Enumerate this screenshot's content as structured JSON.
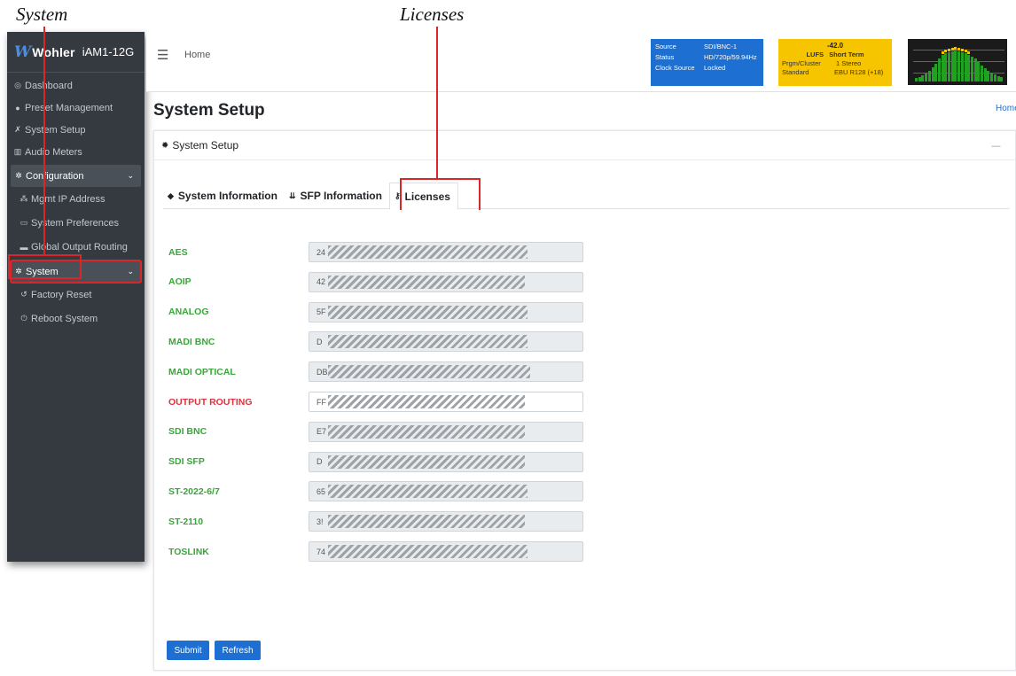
{
  "annotations": {
    "system": "System",
    "licenses": "Licenses"
  },
  "sidebar": {
    "brand_name": "Wohler",
    "brand_model": "iAM1-12G",
    "items": [
      {
        "label": "Dashboard",
        "icon": "tachometer-icon",
        "glyph": "◎"
      },
      {
        "label": "Preset Management",
        "icon": "users-icon",
        "glyph": "👥"
      },
      {
        "label": "System Setup",
        "icon": "tools-icon",
        "glyph": "✗"
      },
      {
        "label": "Audio Meters",
        "icon": "chart-icon",
        "glyph": "▥"
      }
    ],
    "configuration": {
      "label": "Configuration",
      "children": [
        {
          "label": "Mgmt IP Address",
          "icon": "network-icon",
          "glyph": "⁂"
        },
        {
          "label": "System Preferences",
          "icon": "sliders-icon",
          "glyph": "▭"
        },
        {
          "label": "Global Output Routing",
          "icon": "routing-icon",
          "glyph": "▬"
        }
      ]
    },
    "system": {
      "label": "System",
      "children": [
        {
          "label": "Factory Reset",
          "icon": "undo-icon",
          "glyph": "↺"
        },
        {
          "label": "Reboot System",
          "icon": "power-icon",
          "glyph": "⏻"
        }
      ]
    }
  },
  "header": {
    "home": "Home",
    "status": {
      "source_label": "Source",
      "source_value": "SDI/BNC-1",
      "status_label": "Status",
      "status_value": "HD/720p/59.94Hz",
      "clock_label": "Clock Source",
      "clock_value": "Locked"
    },
    "lufs": {
      "value": "-42.0",
      "lufs_label": "LUFS",
      "mode": "Short Term",
      "cluster_label": "Prgm/Cluster",
      "cluster_value": "1  Stereo",
      "standard_label": "Standard",
      "standard_value": "EBU R128 (+18)"
    }
  },
  "page": {
    "title": "System Setup",
    "breadcrumb": "Home",
    "card_title": "System Setup"
  },
  "tabs": [
    {
      "label": "System Information",
      "icon": "tag-icon",
      "glyph": "◆"
    },
    {
      "label": "SFP Information",
      "icon": "plug-icon",
      "glyph": "⇊"
    },
    {
      "label": "Licenses",
      "icon": "key-icon",
      "glyph": "⚷"
    }
  ],
  "licenses": [
    {
      "name": "AES",
      "value": "24"
    },
    {
      "name": "AOIP",
      "value": "42"
    },
    {
      "name": "ANALOG",
      "value": "5F"
    },
    {
      "name": "MADI BNC",
      "value": "D"
    },
    {
      "name": "MADI OPTICAL",
      "value": "DB"
    },
    {
      "name": "OUTPUT ROUTING",
      "value": "FF"
    },
    {
      "name": "SDI BNC",
      "value": "E7"
    },
    {
      "name": "SDI SFP",
      "value": "D"
    },
    {
      "name": "ST-2022-6/7",
      "value": "65"
    },
    {
      "name": "ST-2110",
      "value": "3!"
    },
    {
      "name": "TOSLINK",
      "value": "74"
    }
  ],
  "buttons": {
    "submit": "Submit",
    "refresh": "Refresh"
  },
  "colors": {
    "accent": "#1d6fd1",
    "license_ok": "#3aa63a",
    "license_missing": "#e0303d",
    "sidebar_bg": "#343a40",
    "callout": "#d9262a"
  }
}
